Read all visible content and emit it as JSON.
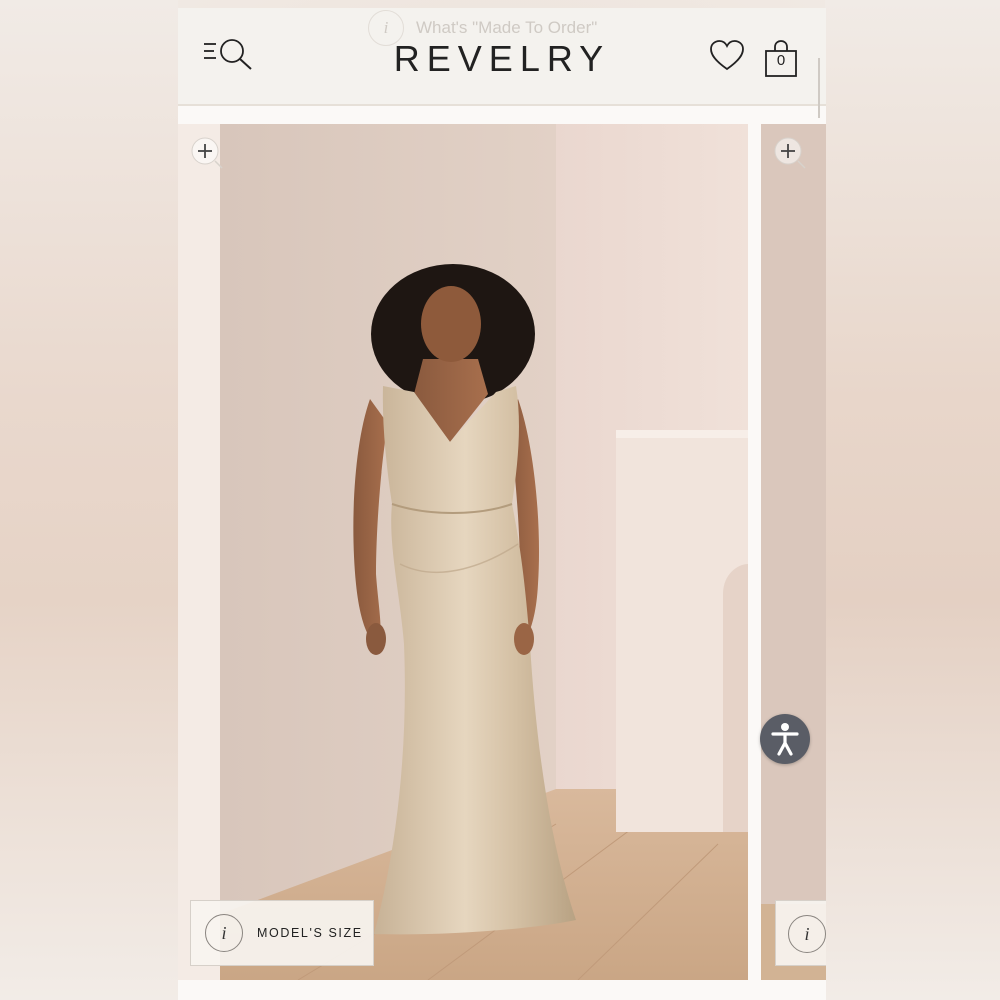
{
  "header": {
    "notice_text": "What's \"Made To Order\"",
    "notice_icon": "info-icon",
    "logo": "REVELRY",
    "cart_count": "0"
  },
  "product_gallery": {
    "model_size_label": "MODEL'S SIZE",
    "zoom_icon": "zoom-in-icon",
    "info_icon": "info-icon"
  },
  "accessibility": {
    "icon": "accessibility-icon",
    "color": "#5a5d66"
  },
  "colors": {
    "brand_text": "#222222",
    "dress": "#d9c6ac",
    "wall": "#e3d2c9"
  }
}
